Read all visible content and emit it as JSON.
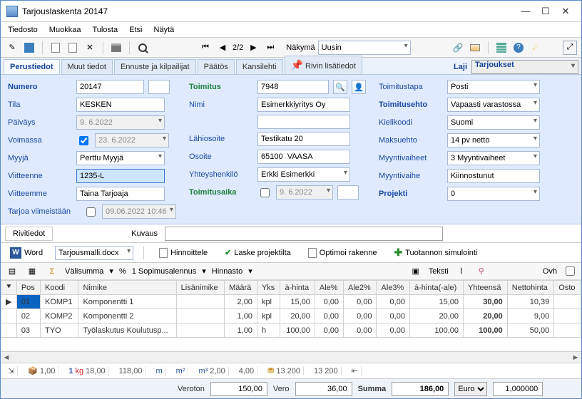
{
  "window": {
    "title": "Tarjouslaskenta 20147"
  },
  "menu": {
    "file": "Tiedosto",
    "edit": "Muokkaa",
    "print": "Tulosta",
    "find": "Etsi",
    "view": "Näytä"
  },
  "toolbar": {
    "page": "2/2",
    "view_label": "Näkymä",
    "view_value": "Uusin"
  },
  "tabs": {
    "perustiedot": "Perustiedot",
    "muut": "Muut tiedot",
    "ennuste": "Ennuste ja kilpailijat",
    "paatos": "Päätös",
    "kansi": "Kansilehti",
    "rivin": "Rivin lisätiedot",
    "laji_label": "Laji",
    "laji_value": "Tarjoukset"
  },
  "form": {
    "left": {
      "numero_lbl": "Numero",
      "numero": "20147",
      "tila_lbl": "Tila",
      "tila": "KESKEN",
      "paivays_lbl": "Päiväys",
      "paivays": "9. 6.2022",
      "voimassa_lbl": "Voimassa",
      "voimassa": "23. 6.2022",
      "myyja_lbl": "Myyjä",
      "myyja": "Perttu Myyjä",
      "viitteenne_lbl": "Viitteenne",
      "viitteenne": "1235-L",
      "viitteemme_lbl": "Viitteemme",
      "viitteemme": "Taina Tarjoaja",
      "tarjoa_lbl": "Tarjoa viimeistään",
      "tarjoa": "09.06.2022 10:46"
    },
    "mid": {
      "toimitus_lbl": "Toimitus",
      "toimitus": "7948",
      "nimi_lbl": "Nimi",
      "nimi": "Esimerkkiyritys Oy",
      "lahiosoite_lbl": "Lähiosoite",
      "lahiosoite": "Testikatu 20",
      "osoite_lbl": "Osoite",
      "osoite": "65100  VAASA",
      "yht_lbl": "Yhteyshenkilö",
      "yht": "Erkki Esimerkki",
      "aika_lbl": "Toimitusaika",
      "aika": "9. 6.2022"
    },
    "right": {
      "toimitustapa_lbl": "Toimitustapa",
      "toimitustapa": "Posti",
      "toimitusehto_lbl": "Toimitusehto",
      "toimitusehto": "Vapaasti varastossa",
      "kieli_lbl": "Kielikoodi",
      "kieli": "Suomi",
      "maksu_lbl": "Maksuehto",
      "maksu": "14 pv netto",
      "vaiheet_lbl": "Myyntivaiheet",
      "vaiheet": "3 Myyntivaiheet",
      "vaihe_lbl": "Myyntivaihe",
      "vaihe": "Kiinnostunut",
      "projekti_lbl": "Projekti",
      "projekti": "0"
    }
  },
  "rivi": {
    "rivitiedot": "Rivitiedot",
    "kuvaus": "Kuvaus"
  },
  "cmd": {
    "word": "Word",
    "template": "Tarjousmalli.docx",
    "hinnoittele": "Hinnoittele",
    "laske": "Laske projektilta",
    "optimoi": "Optimoi rakenne",
    "tuotannon": "Tuotannon simulointi"
  },
  "filter": {
    "valisumma": "Välisumma",
    "pct": "%",
    "sop": "1 Sopimusalennus",
    "hinnasto": "Hinnasto",
    "teksti": "Teksti",
    "ovh": "Ovh"
  },
  "grid": {
    "cols": {
      "pos": "Pos",
      "koodi": "Koodi",
      "nimike": "Nimike",
      "lisa": "Lisänimike",
      "maara": "Määrä",
      "yks": "Yks",
      "ahinta": "à-hinta",
      "ale": "Ale%",
      "ale2": "Ale2%",
      "ale3": "Ale3%",
      "ahintaale": "à-hinta(-ale)",
      "yhteensa": "Yhteensä",
      "netto": "Nettohinta",
      "osto": "Osto"
    },
    "rows": [
      {
        "pos": "01",
        "koodi": "KOMP1",
        "nimike": "Komponentti 1",
        "lisa": "",
        "maara": "2,00",
        "yks": "kpl",
        "ahinta": "15,00",
        "ale": "0,00",
        "ale2": "0,00",
        "ale3": "0,00",
        "ahintaale": "15,00",
        "yhteensa": "30,00",
        "netto": "10,39"
      },
      {
        "pos": "02",
        "koodi": "KOMP2",
        "nimike": "Komponentti 2",
        "lisa": "",
        "maara": "1,00",
        "yks": "kpl",
        "ahinta": "20,00",
        "ale": "0,00",
        "ale2": "0,00",
        "ale3": "0,00",
        "ahintaale": "20,00",
        "yhteensa": "20,00",
        "netto": "9,00"
      },
      {
        "pos": "03",
        "koodi": "TYO",
        "nimike": "Työlaskutus Koulutusp...",
        "lisa": "",
        "maara": "1,00",
        "yks": "h",
        "ahinta": "100,00",
        "ale": "0,00",
        "ale2": "0,00",
        "ale3": "0,00",
        "ahintaale": "100,00",
        "yhteensa": "100,00",
        "netto": "50,00"
      }
    ]
  },
  "status": {
    "v1": "1,00",
    "v2": "18,00",
    "v3": "118,00",
    "v4": "2,00",
    "v5": "4,00",
    "v6": "13 200",
    "v7": "13 200",
    "m2": "m²",
    "m3": "m³",
    "m": "m",
    "kg_i": "1",
    "cube": "1"
  },
  "totals": {
    "veroton_lbl": "Veroton",
    "veroton": "150,00",
    "vero_lbl": "Vero",
    "vero": "36,00",
    "summa_lbl": "Summa",
    "summa": "186,00",
    "currency": "Euro",
    "rate": "1,000000"
  }
}
